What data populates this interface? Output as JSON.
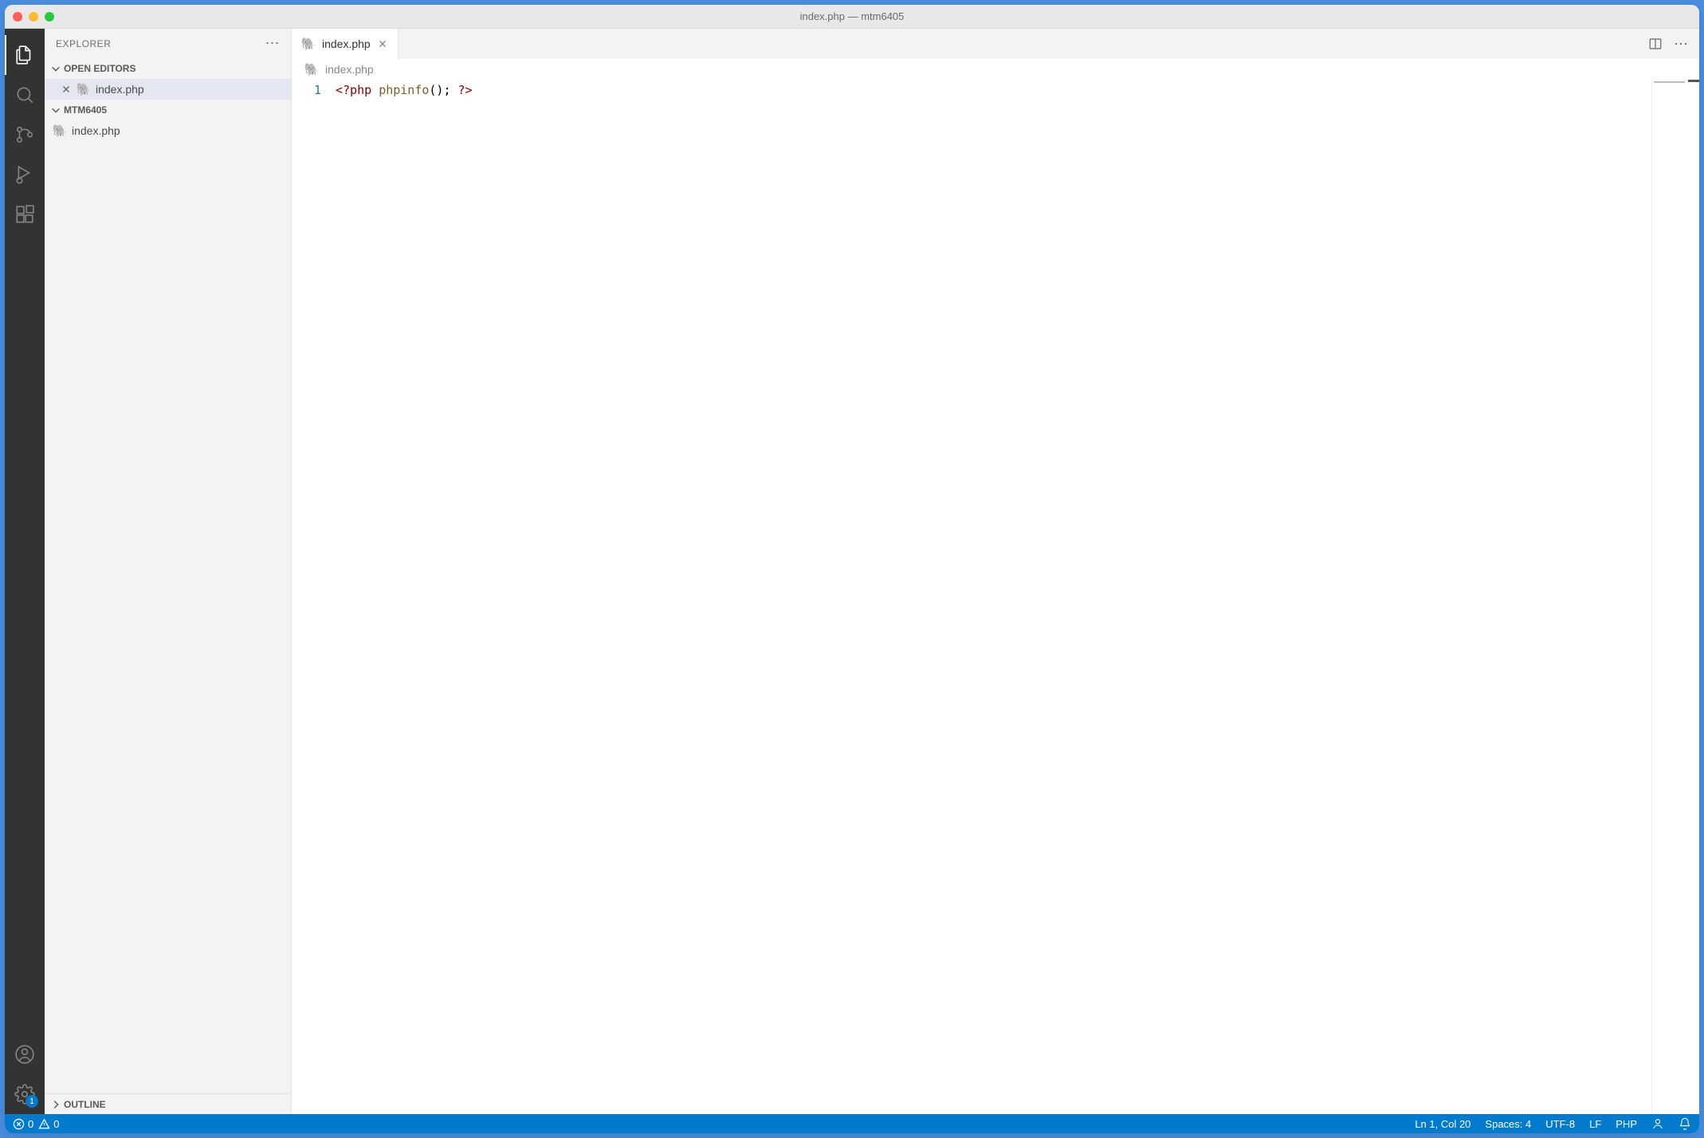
{
  "window": {
    "title": "index.php — mtm6405"
  },
  "sidebar": {
    "title": "EXPLORER",
    "openEditors": {
      "label": "OPEN EDITORS",
      "items": [
        {
          "name": "index.php"
        }
      ]
    },
    "workspace": {
      "label": "MTM6405",
      "items": [
        {
          "name": "index.php"
        }
      ]
    },
    "outline": {
      "label": "OUTLINE"
    }
  },
  "activitybar": {
    "settingsBadge": "1"
  },
  "editor": {
    "tab": {
      "label": "index.php"
    },
    "breadcrumb": "index.php",
    "gutter": {
      "line1": "1"
    },
    "code": {
      "openTag": "<?php",
      "fn": "phpinfo",
      "call": "();",
      "closeTag": "?>"
    }
  },
  "statusbar": {
    "errors": "0",
    "warnings": "0",
    "cursor": "Ln 1, Col 20",
    "spaces": "Spaces: 4",
    "encoding": "UTF-8",
    "eol": "LF",
    "language": "PHP"
  }
}
